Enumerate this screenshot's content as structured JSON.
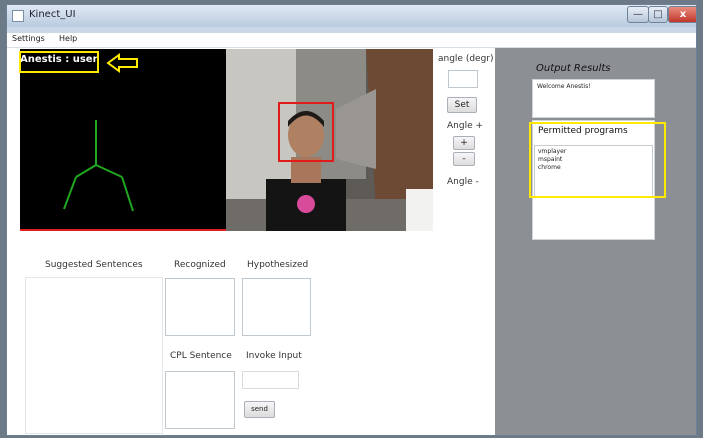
{
  "window": {
    "title": "Kinect_UI",
    "min": "—",
    "max": "□",
    "close": "x"
  },
  "menu": {
    "items": [
      "Settings",
      "Help"
    ]
  },
  "skeleton_panel": {
    "user_label": "Anestis : user",
    "arrow": "⇦"
  },
  "angle": {
    "label": "angle (degr)",
    "value": "",
    "set": "Set",
    "plus_label": "Angle +",
    "plus": "+",
    "minus": "-",
    "minus_label": "Angle -"
  },
  "sentences": {
    "suggested": "Suggested Sentences",
    "recognized": "Recognized",
    "hypothesized": "Hypothesized",
    "cpl": "CPL Sentence",
    "invoke": "Invoke Input",
    "send": "send"
  },
  "output": {
    "title": "Output Results",
    "message": "Welcome Anestis!",
    "permitted_title": "Permitted programs",
    "programs": [
      "vmplayer",
      "mspaint",
      "chrome"
    ]
  }
}
